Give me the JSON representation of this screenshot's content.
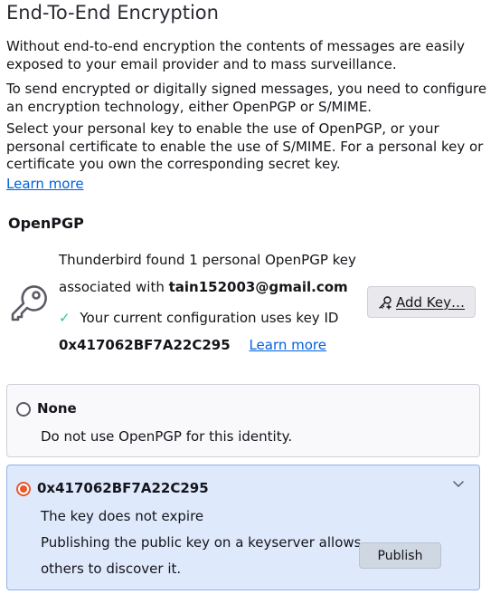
{
  "header": {
    "title": "End-To-End Encryption"
  },
  "intro": {
    "paragraph1": "Without end-to-end encryption the contents of messages are easily exposed to your email provider and to mass surveillance.",
    "paragraph2": "To send encrypted or digitally signed messages, you need to configure an encryption technology, either OpenPGP or S/MIME.",
    "paragraph3": "Select your personal key to enable the use of OpenPGP, or your personal certificate to enable the use of S/MIME. For a personal key or certificate you own the corresponding secret key.",
    "learn_more": "Learn more"
  },
  "openpgp": {
    "section_title": "OpenPGP",
    "found_text": "Thunderbird found 1 personal OpenPGP key",
    "associated_prefix": "associated with",
    "email": "tain152003@gmail.com",
    "check_glyph": "✓",
    "config_text": "Your current configuration uses key ID",
    "key_id": "0x417062BF7A22C295",
    "learn_more": "Learn more",
    "add_key_button": "Add Key…",
    "add_key_icon": "key-plus-icon",
    "key_icon": "key-icon"
  },
  "options": {
    "none": {
      "label": "None",
      "description": "Do not use OpenPGP for this identity.",
      "selected": false
    },
    "key": {
      "label": "0x417062BF7A22C295",
      "expiry": "The key does not expire",
      "publish_text_line1": "Publishing the public key on a keyserver allows",
      "publish_text_line2": "others to discover it.",
      "publish_button": "Publish",
      "selected": true,
      "expanded": true
    }
  },
  "colors": {
    "accent_radio": "#e8582e",
    "link": "#0061e0",
    "check": "#2ac3a2",
    "selected_option_bg": "#deeafc"
  }
}
